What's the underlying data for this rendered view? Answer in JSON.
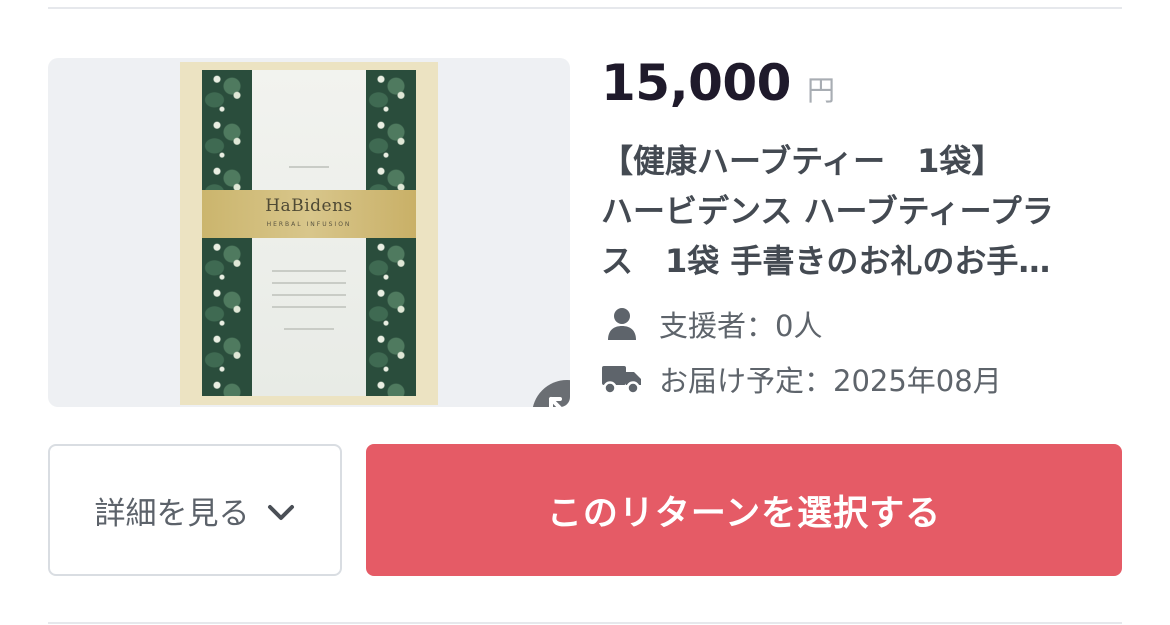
{
  "reward": {
    "image": {
      "brand_text": "HaBidens",
      "brand_subtext": "HERBAL INFUSION"
    },
    "price": {
      "value": "15,000",
      "unit": "円"
    },
    "title_lines": [
      "【健康ハーブティー　1袋】",
      "ハービデンス ハーブティープラ",
      "ス　1袋 手書きのお礼のお手…"
    ],
    "supporters": "支援者：0人",
    "delivery": "お届け予定：2025年08月",
    "icons": {
      "supporters": "person-icon",
      "delivery": "truck-icon",
      "expand": "expand-icon",
      "chevron": "chevron-down-icon"
    }
  },
  "actions": {
    "details_label": "詳細を見る",
    "select_label": "このリターンを選択する"
  },
  "colors": {
    "accent": "#e55b66",
    "price_text": "#1f1a2b",
    "muted_text": "#5e646b"
  }
}
